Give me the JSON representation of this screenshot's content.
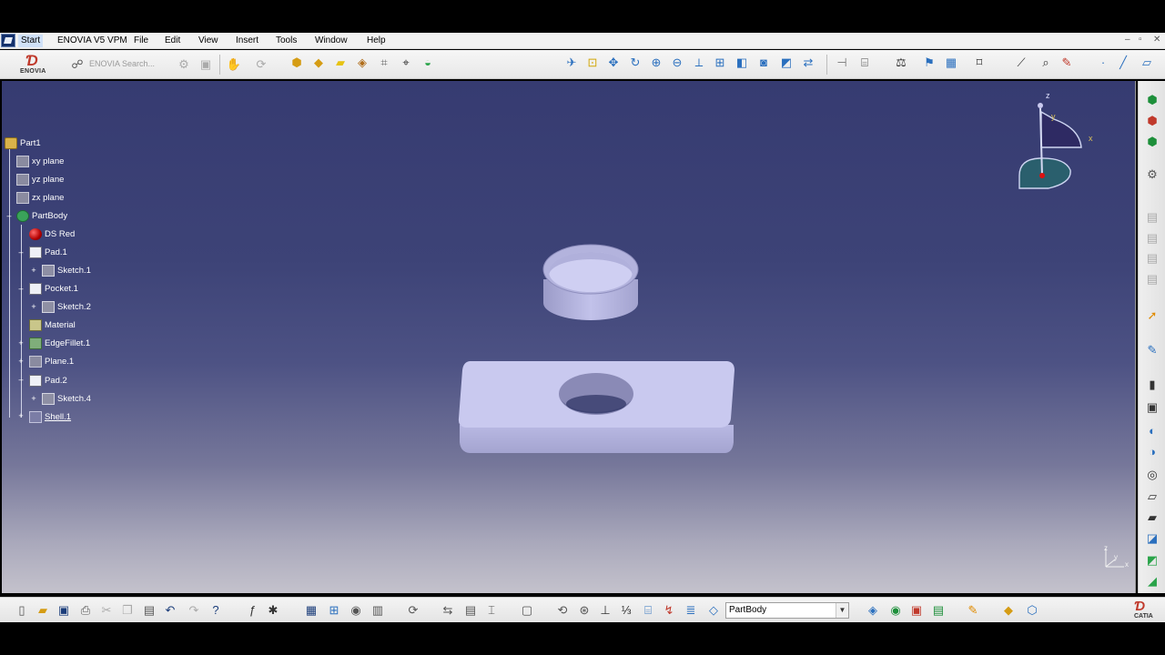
{
  "menu": {
    "start": "Start",
    "enovia": "ENOVIA V5 VPM",
    "file": "File",
    "edit": "Edit",
    "view": "View",
    "insert": "Insert",
    "tools": "Tools",
    "window": "Window",
    "help": "Help"
  },
  "window_controls": {
    "minimize": "–",
    "restore": "▫",
    "close": "✕"
  },
  "toolbar_top": {
    "enovia_logo_text": "ENOVIA",
    "enovia_search_placeholder": "ENOVIA Search..."
  },
  "spec_tree": {
    "root": "Part1",
    "items": [
      {
        "label": "xy plane",
        "icon": "plane-icon"
      },
      {
        "label": "yz plane",
        "icon": "plane-icon"
      },
      {
        "label": "zx plane",
        "icon": "plane-icon"
      },
      {
        "label": "PartBody",
        "icon": "body-icon"
      },
      {
        "label": "DS Red",
        "icon": "material-sphere-icon"
      },
      {
        "label": "Pad.1",
        "icon": "pad-icon"
      },
      {
        "label": "Sketch.1",
        "icon": "sketch-icon"
      },
      {
        "label": "Pocket.1",
        "icon": "pocket-icon"
      },
      {
        "label": "Sketch.2",
        "icon": "sketch-icon"
      },
      {
        "label": "Material",
        "icon": "material-icon"
      },
      {
        "label": "EdgeFillet.1",
        "icon": "fillet-icon"
      },
      {
        "label": "Plane.1",
        "icon": "plane-icon"
      },
      {
        "label": "Pad.2",
        "icon": "pad-icon"
      },
      {
        "label": "Sketch.4",
        "icon": "sketch-icon"
      },
      {
        "label": "Shell.1",
        "icon": "shell-icon"
      }
    ]
  },
  "compass": {
    "z": "z",
    "x": "x",
    "y": "y"
  },
  "axis_triad": {
    "x": "x",
    "y": "y",
    "z": "z"
  },
  "toolbar_bottom": {
    "current_body": "PartBody",
    "catia_logo_text": "CATIA"
  },
  "colors": {
    "viewport_top": "#363b71",
    "viewport_bottom": "#c4c2cc",
    "part_face": "#c8c8ee",
    "part_side": "#a9a9d6"
  }
}
